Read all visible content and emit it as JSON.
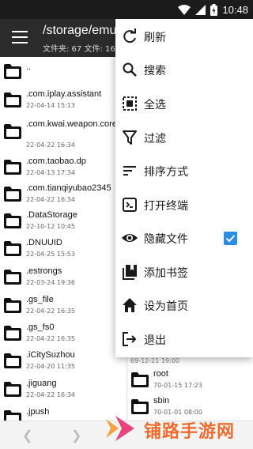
{
  "status_bar": {
    "time": "10:48"
  },
  "app_bar": {
    "title": "/storage/emu",
    "subtitle": "文件夹: 67  文件: 16"
  },
  "files": [
    {
      "name": "..",
      "date": ""
    },
    {
      "name": ".com.iplay.assistant",
      "date": "22-04-14 15:13"
    },
    {
      "name": ".com.kwai.weapon.core",
      "date": "22-04-22 16:34"
    },
    {
      "name": ".com.taobao.dp",
      "date": "22-04-13 17:34"
    },
    {
      "name": ".com.tianqiyubao2345",
      "date": "22-04-22 16:34"
    },
    {
      "name": ".DataStorage",
      "date": "22-10-12 10:45"
    },
    {
      "name": ".DNUUID",
      "date": "22-04-25 15:53"
    },
    {
      "name": ".estrongs",
      "date": "22-03-24 19:36"
    },
    {
      "name": ".gs_file",
      "date": "22-04-22 16:35"
    },
    {
      "name": ".gs_fs0",
      "date": "22-04-22 16:35"
    },
    {
      "name": ".iCitySuzhou",
      "date": "22-04-20 11:35"
    },
    {
      "name": ".jiguang",
      "date": "22-04-22 16:34"
    },
    {
      "name": ".jpush",
      "date": ""
    }
  ],
  "right_pane": {
    "partial_date": "69-12-21 19:00",
    "files": [
      {
        "name": "root",
        "date": "70-01-15 17:23"
      },
      {
        "name": "sbin",
        "date": "70-01-01 08:00"
      }
    ]
  },
  "menu": {
    "items": [
      {
        "label": "刷新",
        "icon": "refresh-icon"
      },
      {
        "label": "搜索",
        "icon": "search-icon"
      },
      {
        "label": "全选",
        "icon": "select-all-icon"
      },
      {
        "label": "过滤",
        "icon": "filter-icon"
      },
      {
        "label": "排序方式",
        "icon": "sort-icon"
      },
      {
        "label": "打开终端",
        "icon": "terminal-icon"
      },
      {
        "label": "隐藏文件",
        "icon": "eye-icon",
        "checked": true
      },
      {
        "label": "添加书签",
        "icon": "bookmark-icon"
      },
      {
        "label": "设为首页",
        "icon": "home-icon"
      },
      {
        "label": "退出",
        "icon": "exit-icon"
      }
    ]
  },
  "watermark": {
    "text": "铺路手游网"
  },
  "colors": {
    "app_bar": "#2b2b2b",
    "status_bar": "#1c1c1c",
    "checkbox": "#2a8de5",
    "watermark": "#ef6c2f"
  }
}
